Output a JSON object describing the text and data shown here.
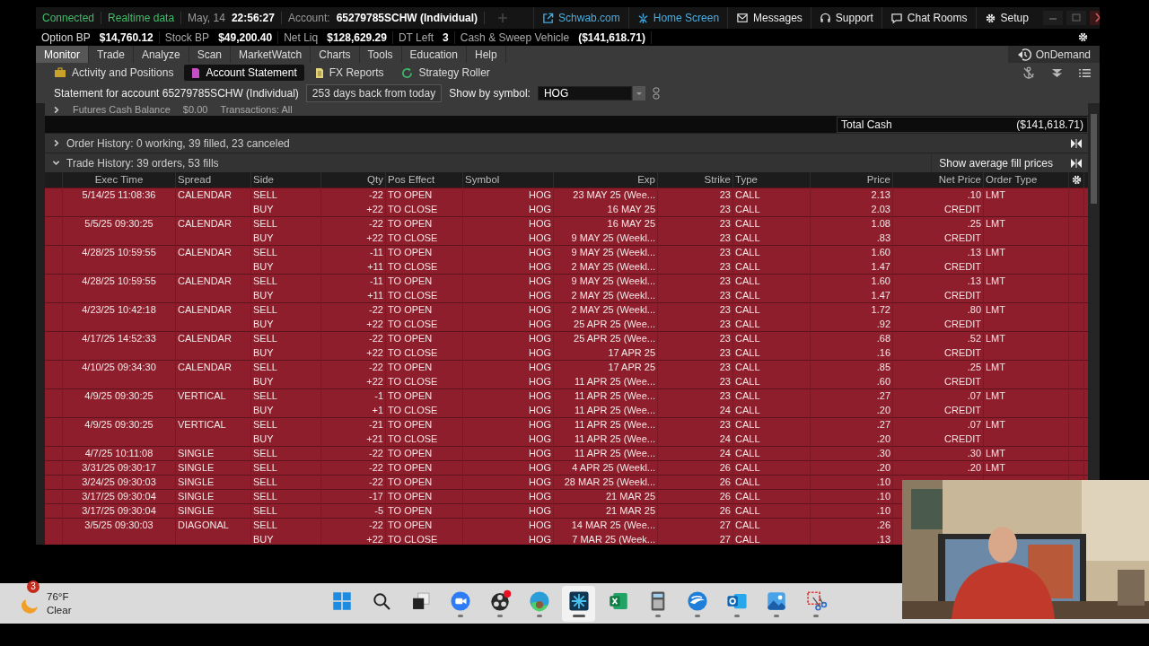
{
  "header": {
    "connection": "Connected",
    "data_feed": "Realtime data",
    "date": "May, 14",
    "time": "22:56:27",
    "account_label": "Account:",
    "account": "65279785SCHW (Individual)",
    "links": [
      {
        "label": "Schwab.com",
        "kind": "external"
      },
      {
        "label": "Home Screen",
        "kind": "home"
      },
      {
        "label": "Messages",
        "kind": "mail"
      },
      {
        "label": "Support",
        "kind": "headset"
      },
      {
        "label": "Chat Rooms",
        "kind": "chat"
      },
      {
        "label": "Setup",
        "kind": "gear"
      }
    ]
  },
  "balances": [
    {
      "label": "Option BP",
      "value": "$14,760.12"
    },
    {
      "label": "Stock BP",
      "value": "$49,200.40"
    },
    {
      "label": "Net Liq",
      "value": "$128,629.29"
    },
    {
      "label": "DT Left",
      "value": "3"
    },
    {
      "label": "Cash & Sweep Vehicle",
      "value": "($141,618.71)"
    }
  ],
  "main_tabs": [
    {
      "label": "Monitor",
      "selected": true
    },
    {
      "label": "Trade",
      "selected": false
    },
    {
      "label": "Analyze",
      "selected": false
    },
    {
      "label": "Scan",
      "selected": false
    },
    {
      "label": "MarketWatch",
      "selected": false
    },
    {
      "label": "Charts",
      "selected": false
    },
    {
      "label": "Tools",
      "selected": false
    },
    {
      "label": "Education",
      "selected": false
    },
    {
      "label": "Help",
      "selected": false
    }
  ],
  "on_demand": "OnDemand",
  "sub_tabs": [
    {
      "label": "Activity and Positions",
      "selected": false,
      "kind": "briefcase"
    },
    {
      "label": "Account Statement",
      "selected": true,
      "kind": "statement"
    },
    {
      "label": "FX Reports",
      "selected": false,
      "kind": "report"
    },
    {
      "label": "Strategy Roller",
      "selected": false,
      "kind": "roller"
    }
  ],
  "statement": {
    "account_text": "Statement for account 65279785SCHW (Individual)",
    "range": "253 days back from today",
    "symbol_label": "Show by symbol:",
    "symbol": "HOG"
  },
  "futures": {
    "label": "Futures Cash Balance",
    "value": "$0.00",
    "transactions": "Transactions: All"
  },
  "total_cash": {
    "label": "Total Cash",
    "value": "($141,618.71)"
  },
  "sections": [
    {
      "title": "Order History: 0 working, 39 filled, 23 canceled",
      "expanded": false
    },
    {
      "title": "Trade History: 39 orders, 53 fills",
      "expanded": true,
      "action": "Show average fill prices"
    }
  ],
  "table": {
    "columns": [
      "Exec Time",
      "Spread",
      "Side",
      "Qty",
      "Pos Effect",
      "Symbol",
      "Exp",
      "Strike",
      "Type",
      "Price",
      "Net Price",
      "Order Type"
    ],
    "rows": [
      {
        "exec_time": "5/14/25 11:08:36",
        "spread": "CALENDAR",
        "side": "SELL",
        "qty": "-22",
        "pos_effect": "TO OPEN",
        "symbol": "HOG",
        "exp": "23 MAY 25 (Wee...",
        "strike": "23",
        "type": "CALL",
        "price": "2.13",
        "net_price": ".10",
        "order_type": "LMT"
      },
      {
        "side": "BUY",
        "qty": "+22",
        "pos_effect": "TO CLOSE",
        "symbol": "HOG",
        "exp": "16 MAY 25",
        "strike": "23",
        "type": "CALL",
        "price": "2.03",
        "net_price": "CREDIT"
      },
      {
        "exec_time": "5/5/25 09:30:25",
        "spread": "CALENDAR",
        "side": "SELL",
        "qty": "-22",
        "pos_effect": "TO OPEN",
        "symbol": "HOG",
        "exp": "16 MAY 25",
        "strike": "23",
        "type": "CALL",
        "price": "1.08",
        "net_price": ".25",
        "order_type": "LMT"
      },
      {
        "side": "BUY",
        "qty": "+22",
        "pos_effect": "TO CLOSE",
        "symbol": "HOG",
        "exp": "9 MAY 25 (Weekl...",
        "strike": "23",
        "type": "CALL",
        "price": ".83",
        "net_price": "CREDIT"
      },
      {
        "exec_time": "4/28/25 10:59:55",
        "spread": "CALENDAR",
        "side": "SELL",
        "qty": "-11",
        "pos_effect": "TO OPEN",
        "symbol": "HOG",
        "exp": "9 MAY 25 (Weekl...",
        "strike": "23",
        "type": "CALL",
        "price": "1.60",
        "net_price": ".13",
        "order_type": "LMT"
      },
      {
        "side": "BUY",
        "qty": "+11",
        "pos_effect": "TO CLOSE",
        "symbol": "HOG",
        "exp": "2 MAY 25 (Weekl...",
        "strike": "23",
        "type": "CALL",
        "price": "1.47",
        "net_price": "CREDIT"
      },
      {
        "exec_time": "4/28/25 10:59:55",
        "spread": "CALENDAR",
        "side": "SELL",
        "qty": "-11",
        "pos_effect": "TO OPEN",
        "symbol": "HOG",
        "exp": "9 MAY 25 (Weekl...",
        "strike": "23",
        "type": "CALL",
        "price": "1.60",
        "net_price": ".13",
        "order_type": "LMT"
      },
      {
        "side": "BUY",
        "qty": "+11",
        "pos_effect": "TO CLOSE",
        "symbol": "HOG",
        "exp": "2 MAY 25 (Weekl...",
        "strike": "23",
        "type": "CALL",
        "price": "1.47",
        "net_price": "CREDIT"
      },
      {
        "exec_time": "4/23/25 10:42:18",
        "spread": "CALENDAR",
        "side": "SELL",
        "qty": "-22",
        "pos_effect": "TO OPEN",
        "symbol": "HOG",
        "exp": "2 MAY 25 (Weekl...",
        "strike": "23",
        "type": "CALL",
        "price": "1.72",
        "net_price": ".80",
        "order_type": "LMT"
      },
      {
        "side": "BUY",
        "qty": "+22",
        "pos_effect": "TO CLOSE",
        "symbol": "HOG",
        "exp": "25 APR 25 (Wee...",
        "strike": "23",
        "type": "CALL",
        "price": ".92",
        "net_price": "CREDIT"
      },
      {
        "exec_time": "4/17/25 14:52:33",
        "spread": "CALENDAR",
        "side": "SELL",
        "qty": "-22",
        "pos_effect": "TO OPEN",
        "symbol": "HOG",
        "exp": "25 APR 25 (Wee...",
        "strike": "23",
        "type": "CALL",
        "price": ".68",
        "net_price": ".52",
        "order_type": "LMT"
      },
      {
        "side": "BUY",
        "qty": "+22",
        "pos_effect": "TO CLOSE",
        "symbol": "HOG",
        "exp": "17 APR 25",
        "strike": "23",
        "type": "CALL",
        "price": ".16",
        "net_price": "CREDIT"
      },
      {
        "exec_time": "4/10/25 09:34:30",
        "spread": "CALENDAR",
        "side": "SELL",
        "qty": "-22",
        "pos_effect": "TO OPEN",
        "symbol": "HOG",
        "exp": "17 APR 25",
        "strike": "23",
        "type": "CALL",
        "price": ".85",
        "net_price": ".25",
        "order_type": "LMT"
      },
      {
        "side": "BUY",
        "qty": "+22",
        "pos_effect": "TO CLOSE",
        "symbol": "HOG",
        "exp": "11 APR 25 (Wee...",
        "strike": "23",
        "type": "CALL",
        "price": ".60",
        "net_price": "CREDIT"
      },
      {
        "exec_time": "4/9/25 09:30:25",
        "spread": "VERTICAL",
        "side": "SELL",
        "qty": "-1",
        "pos_effect": "TO OPEN",
        "symbol": "HOG",
        "exp": "11 APR 25 (Wee...",
        "strike": "23",
        "type": "CALL",
        "price": ".27",
        "net_price": ".07",
        "order_type": "LMT"
      },
      {
        "side": "BUY",
        "qty": "+1",
        "pos_effect": "TO CLOSE",
        "symbol": "HOG",
        "exp": "11 APR 25 (Wee...",
        "strike": "24",
        "type": "CALL",
        "price": ".20",
        "net_price": "CREDIT"
      },
      {
        "exec_time": "4/9/25 09:30:25",
        "spread": "VERTICAL",
        "side": "SELL",
        "qty": "-21",
        "pos_effect": "TO OPEN",
        "symbol": "HOG",
        "exp": "11 APR 25 (Wee...",
        "strike": "23",
        "type": "CALL",
        "price": ".27",
        "net_price": ".07",
        "order_type": "LMT"
      },
      {
        "side": "BUY",
        "qty": "+21",
        "pos_effect": "TO CLOSE",
        "symbol": "HOG",
        "exp": "11 APR 25 (Wee...",
        "strike": "24",
        "type": "CALL",
        "price": ".20",
        "net_price": "CREDIT"
      },
      {
        "exec_time": "4/7/25 10:11:08",
        "spread": "SINGLE",
        "side": "SELL",
        "qty": "-22",
        "pos_effect": "TO OPEN",
        "symbol": "HOG",
        "exp": "11 APR 25 (Wee...",
        "strike": "24",
        "type": "CALL",
        "price": ".30",
        "net_price": ".30",
        "order_type": "LMT"
      },
      {
        "exec_time": "3/31/25 09:30:17",
        "spread": "SINGLE",
        "side": "SELL",
        "qty": "-22",
        "pos_effect": "TO OPEN",
        "symbol": "HOG",
        "exp": "4 APR 25 (Weekl...",
        "strike": "26",
        "type": "CALL",
        "price": ".20",
        "net_price": ".20",
        "order_type": "LMT"
      },
      {
        "exec_time": "3/24/25 09:30:03",
        "spread": "SINGLE",
        "side": "SELL",
        "qty": "-22",
        "pos_effect": "TO OPEN",
        "symbol": "HOG",
        "exp": "28 MAR 25 (Weekl...",
        "strike": "26",
        "type": "CALL",
        "price": ".10"
      },
      {
        "exec_time": "3/17/25 09:30:04",
        "spread": "SINGLE",
        "side": "SELL",
        "qty": "-17",
        "pos_effect": "TO OPEN",
        "symbol": "HOG",
        "exp": "21 MAR 25",
        "strike": "26",
        "type": "CALL",
        "price": ".10"
      },
      {
        "exec_time": "3/17/25 09:30:04",
        "spread": "SINGLE",
        "side": "SELL",
        "qty": "-5",
        "pos_effect": "TO OPEN",
        "symbol": "HOG",
        "exp": "21 MAR 25",
        "strike": "26",
        "type": "CALL",
        "price": ".10"
      },
      {
        "exec_time": "3/5/25 09:30:03",
        "spread": "DIAGONAL",
        "side": "SELL",
        "qty": "-22",
        "pos_effect": "TO OPEN",
        "symbol": "HOG",
        "exp": "14 MAR 25 (Wee...",
        "strike": "27",
        "type": "CALL",
        "price": ".26"
      },
      {
        "side": "BUY",
        "qty": "+22",
        "pos_effect": "TO CLOSE",
        "symbol": "HOG",
        "exp": "7 MAR 25 (Week...",
        "strike": "27",
        "type": "CALL",
        "price": ".13"
      }
    ]
  },
  "taskbar": {
    "weather": {
      "badge": "3",
      "temperature": "76°F",
      "condition": "Clear"
    },
    "apps": [
      {
        "kind": "start",
        "running": false,
        "selected": false
      },
      {
        "kind": "search",
        "running": false,
        "selected": false
      },
      {
        "kind": "taskview",
        "running": false,
        "selected": false
      },
      {
        "kind": "video",
        "running": true,
        "selected": false
      },
      {
        "kind": "recorder",
        "running": true,
        "selected": false
      },
      {
        "kind": "browser",
        "running": true,
        "selected": false
      },
      {
        "kind": "trading",
        "running": true,
        "selected": true
      },
      {
        "kind": "spreadsheet",
        "running": false,
        "selected": false
      },
      {
        "kind": "calculator",
        "running": true,
        "selected": false
      },
      {
        "kind": "bird",
        "running": true,
        "selected": false
      },
      {
        "kind": "mail",
        "running": true,
        "selected": false
      },
      {
        "kind": "photos",
        "running": true,
        "selected": false
      },
      {
        "kind": "snip",
        "running": true,
        "selected": false
      }
    ]
  }
}
